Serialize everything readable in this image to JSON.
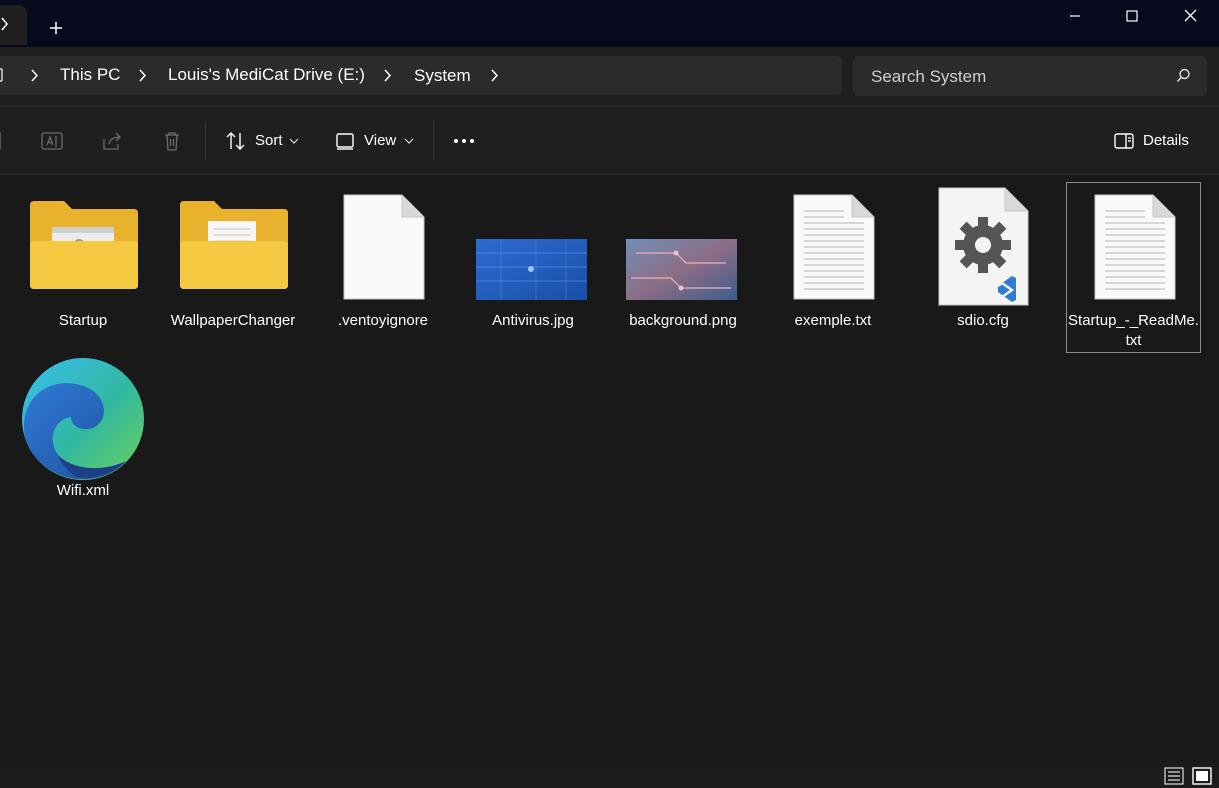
{
  "window": {
    "new_tab_label": "+",
    "minimize_label": "Minimize",
    "maximize_label": "Maximize",
    "close_label": "Close"
  },
  "address": {
    "crumbs": [
      "This PC",
      "Louis's MediCat Drive (E:)",
      "System"
    ]
  },
  "search": {
    "placeholder": "Search System"
  },
  "toolbar": {
    "sort_label": "Sort",
    "view_label": "View",
    "details_label": "Details"
  },
  "items": [
    {
      "name": "Startup",
      "kind": "folder"
    },
    {
      "name": "WallpaperChanger",
      "kind": "folder"
    },
    {
      "name": ".ventoyignore",
      "kind": "file"
    },
    {
      "name": "Antivirus.jpg",
      "kind": "image"
    },
    {
      "name": "background.png",
      "kind": "image"
    },
    {
      "name": "exemple.txt",
      "kind": "text"
    },
    {
      "name": "sdio.cfg",
      "kind": "config"
    },
    {
      "name": "Startup_-_ReadMe.txt",
      "kind": "text",
      "selected": true
    },
    {
      "name": "Wifi.xml",
      "kind": "edge"
    }
  ],
  "colors": {
    "titlebar": "#060a1c",
    "background": "#191919",
    "folder": "#f5c842",
    "accent_blue": "#2f7bd6"
  }
}
